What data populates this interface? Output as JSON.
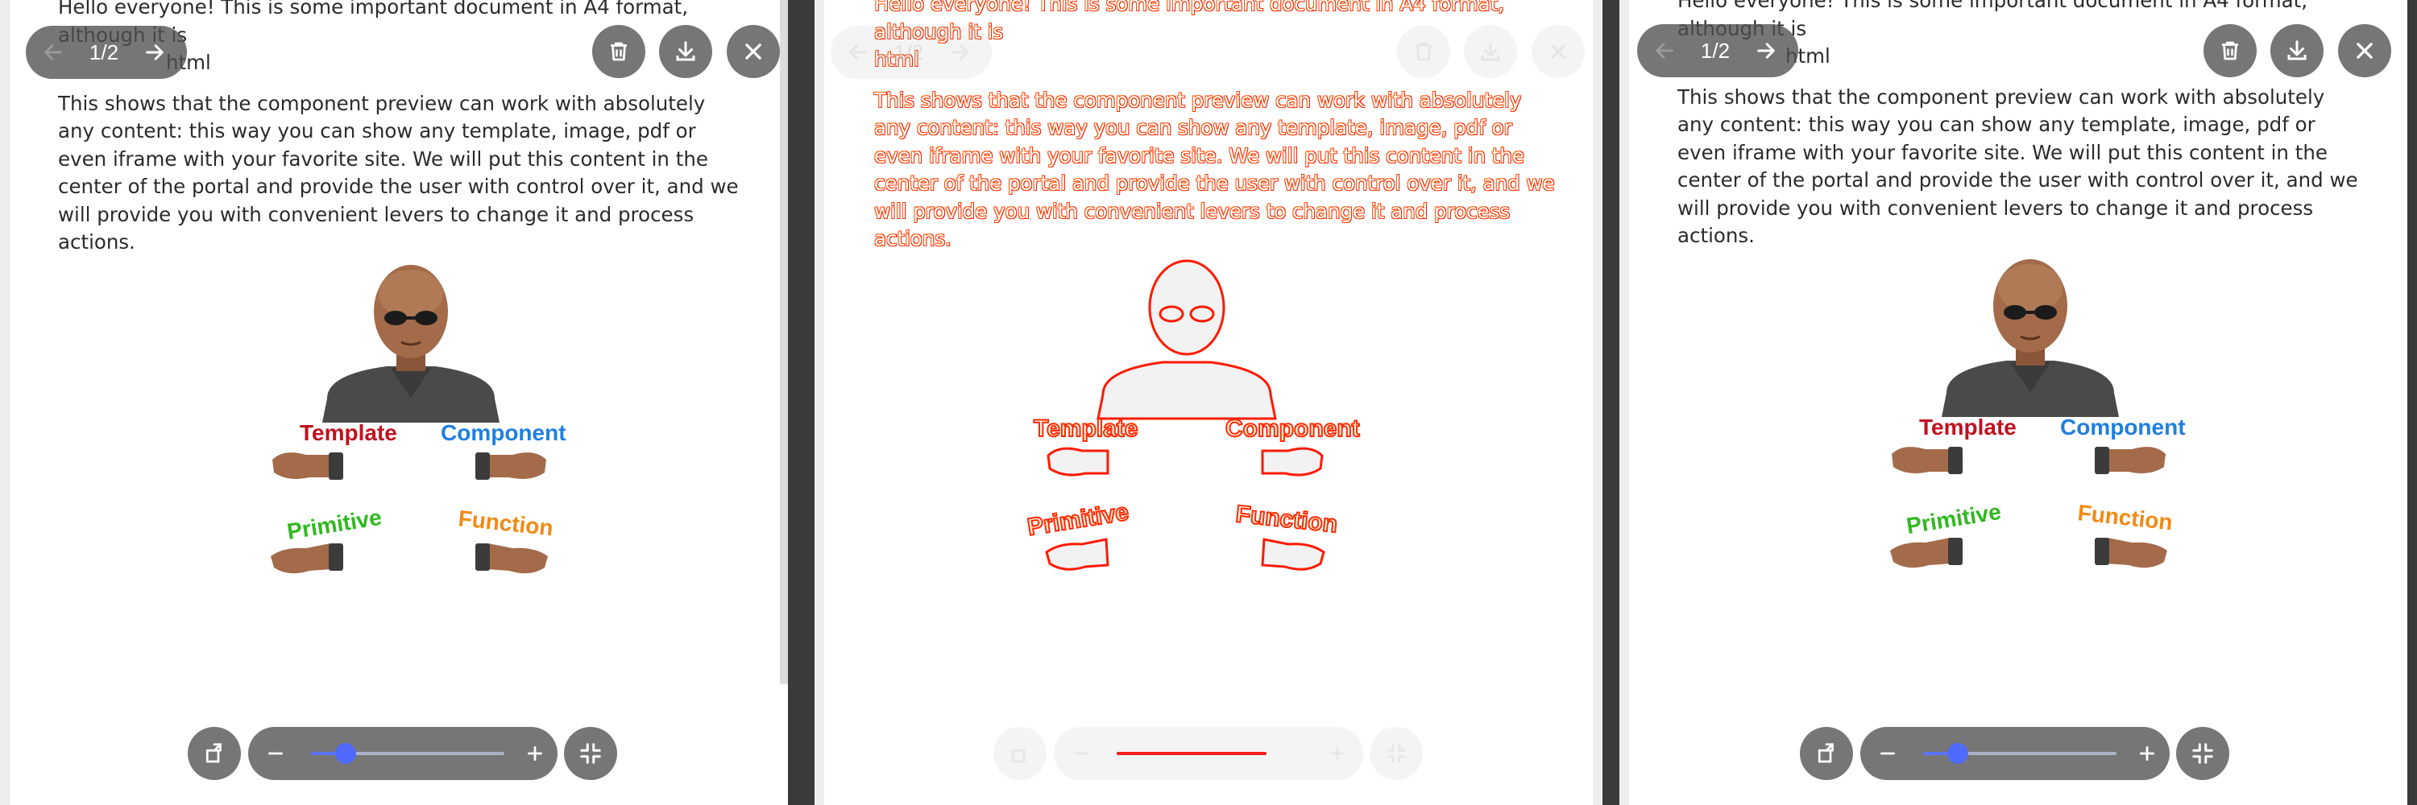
{
  "document": {
    "line1": "Hello everyone! This is some important document in A4 format, although it is",
    "line2": "html",
    "paragraph": "This shows that the component preview can work with absolutely any content: this way you can show any template, image, pdf or even iframe with your favorite site. We will put this content in the center of the portal and provide the user with control over it, and we will provide you with convenient levers to change it and process actions."
  },
  "illustration": {
    "labels": {
      "template": "Template",
      "component": "Component",
      "primitive": "Primitive",
      "function": "Function"
    },
    "colors": {
      "template": "#c0111f",
      "component": "#1f7fe0",
      "primitive": "#2fb91f",
      "function": "#f08a14",
      "skin": "#a36b4a",
      "clothing": "#4a4a4a"
    }
  },
  "toolbar": {
    "pagination": "1/2",
    "zoom_fraction": 0.18
  },
  "icons": {
    "prev": "arrow-left-icon",
    "next": "arrow-right-icon",
    "delete": "trash-icon",
    "download": "download-icon",
    "close": "close-icon",
    "rotate": "rotate-icon",
    "zoom_out": "minus-icon",
    "zoom_in": "plus-icon",
    "fullscreen": "collapse-icon"
  },
  "colors": {
    "control_bg": "#505050",
    "slider_accent": "#5b74ff",
    "outline_accent": "#ff1a00"
  }
}
